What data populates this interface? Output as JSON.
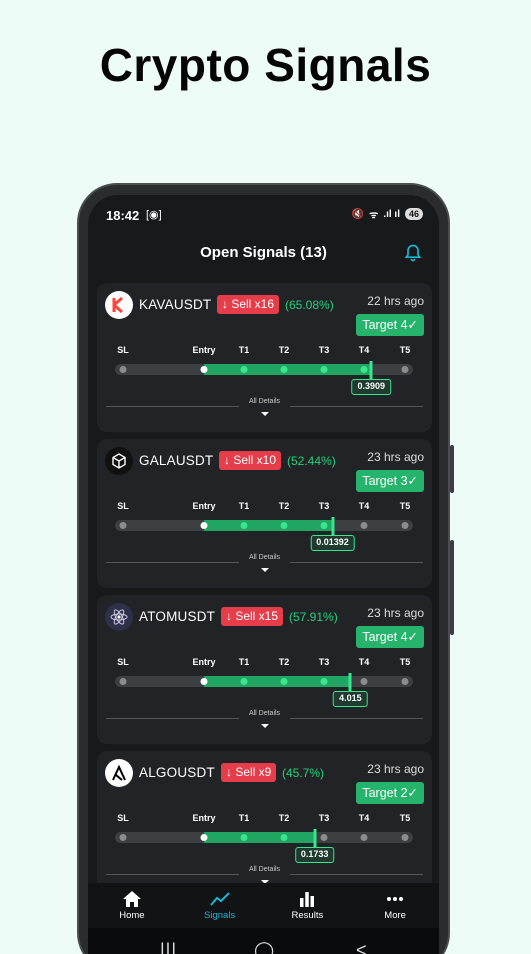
{
  "promo": {
    "title": "Crypto Signals"
  },
  "status_bar": {
    "time": "18:42",
    "screenshot_glyph": "[◉]",
    "mute": "🔇",
    "wifi": "ᯤ",
    "signal": ".ıl ıl",
    "battery": "46"
  },
  "header": {
    "title": "Open Signals (13)",
    "icon": "bell-icon"
  },
  "level_labels": [
    "SL",
    "Entry",
    "T1",
    "T2",
    "T3",
    "T4",
    "T5"
  ],
  "details_label": "All Details",
  "cards": [
    {
      "symbol": "KAVAUSDT",
      "sell": "↓ Sell x16",
      "pct": "(65.08%)",
      "time": "22 hrs ago",
      "target": "Target 4✓",
      "price": "0.3909",
      "logo": "kava-logo-icon",
      "progress": 0.86
    },
    {
      "symbol": "GALAUSDT",
      "sell": "↓ Sell x10",
      "pct": "(52.44%)",
      "time": "23 hrs ago",
      "target": "Target 3✓",
      "price": "0.01392",
      "logo": "gala-logo-icon",
      "progress": 0.73
    },
    {
      "symbol": "ATOMUSDT",
      "sell": "↓ Sell x15",
      "pct": "(57.91%)",
      "time": "23 hrs ago",
      "target": "Target 4✓",
      "price": "4.015",
      "logo": "atom-logo-icon",
      "progress": 0.79
    },
    {
      "symbol": "ALGOUSDT",
      "sell": "↓ Sell x9",
      "pct": "(45.7%)",
      "time": "23 hrs ago",
      "target": "Target 2✓",
      "price": "0.1733",
      "logo": "algo-logo-icon",
      "progress": 0.67
    }
  ],
  "nav": [
    {
      "label": "Home",
      "icon": "home-icon"
    },
    {
      "label": "Signals",
      "icon": "signals-icon",
      "active": true
    },
    {
      "label": "Results",
      "icon": "results-icon"
    },
    {
      "label": "More",
      "icon": "more-icon"
    }
  ],
  "system_nav": {
    "recents": "|||",
    "home": "◯",
    "back": "<"
  },
  "colors": {
    "sell": "#e53d4a",
    "green": "#26d07c",
    "target": "#26b36c",
    "accent": "#18b7d6"
  }
}
